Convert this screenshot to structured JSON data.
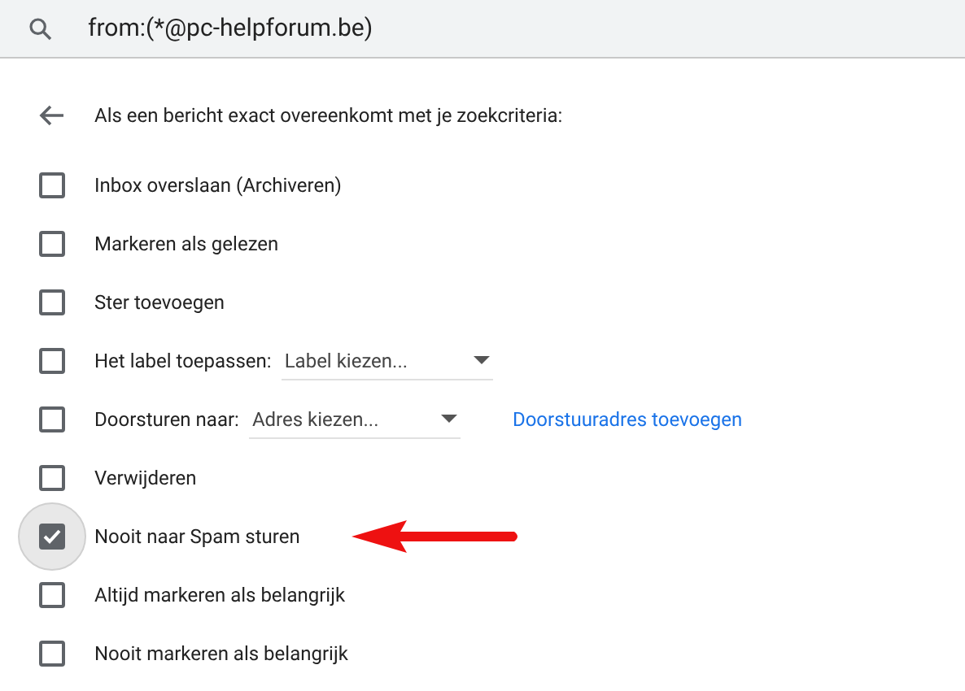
{
  "search": {
    "value": "from:(*@pc-helpforum.be)"
  },
  "header": {
    "text": "Als een bericht exact overeenkomt met je zoekcriteria:"
  },
  "options": [
    {
      "kind": "option",
      "label": "Inbox overslaan (Archiveren)",
      "checked": false,
      "focused": false,
      "pointer_arrow": false
    },
    {
      "kind": "option",
      "label": "Markeren als gelezen",
      "checked": false,
      "focused": false,
      "pointer_arrow": false
    },
    {
      "kind": "option",
      "label": "Ster toevoegen",
      "checked": false,
      "focused": false,
      "pointer_arrow": false
    },
    {
      "kind": "select",
      "label": "Het label toepassen:",
      "select": "Label kiezen...",
      "checked": false,
      "focused": false,
      "pointer_arrow": false
    },
    {
      "kind": "select",
      "label": "Doorsturen naar:",
      "select": "Adres kiezen...",
      "link": "Doorstuuradres toevoegen",
      "checked": false,
      "focused": false,
      "pointer_arrow": false
    },
    {
      "kind": "option",
      "label": "Verwijderen",
      "checked": false,
      "focused": false,
      "pointer_arrow": false
    },
    {
      "kind": "option",
      "label": "Nooit naar Spam sturen",
      "checked": true,
      "focused": true,
      "pointer_arrow": true
    },
    {
      "kind": "option",
      "label": "Altijd markeren als belangrijk",
      "checked": false,
      "focused": false,
      "pointer_arrow": false
    },
    {
      "kind": "option",
      "label": "Nooit markeren als belangrijk",
      "checked": false,
      "focused": false,
      "pointer_arrow": false
    }
  ]
}
